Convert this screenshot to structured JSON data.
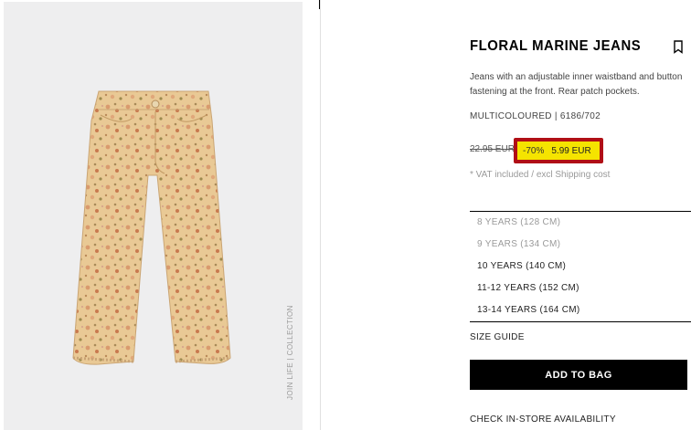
{
  "product": {
    "image_alt": "Floral marine jeans",
    "collection_label": "JOIN LIFE | COLLECTION",
    "title": "FLORAL MARINE JEANS",
    "description": "Jeans with an adjustable inner waistband and button fastening at the front. Rear patch pockets.",
    "colour_ref": "MULTICOLOURED | 6186/702",
    "old_price": "22.95 EUR",
    "discount": "-70%",
    "new_price": "5.99 EUR",
    "vat_note": "* VAT included / excl Shipping cost"
  },
  "sizes": [
    {
      "label": "8 YEARS (128 CM)",
      "available": false
    },
    {
      "label": "9 YEARS (134 CM)",
      "available": false
    },
    {
      "label": "10 YEARS (140 CM)",
      "available": true
    },
    {
      "label": "11-12 YEARS (152 CM)",
      "available": true
    },
    {
      "label": "13-14 YEARS (164 CM)",
      "available": true
    }
  ],
  "actions": {
    "size_guide": "SIZE GUIDE",
    "add_to_bag": "ADD TO BAG",
    "check_store": "CHECK IN-STORE AVAILABILITY"
  },
  "colors": {
    "highlight": "#f5e400",
    "highlight_border": "#b00f16",
    "button_bg": "#000000",
    "image_bg": "#eeeeef",
    "fabric": "#e9c995"
  },
  "icons": {
    "bookmark": "bookmark-icon"
  }
}
